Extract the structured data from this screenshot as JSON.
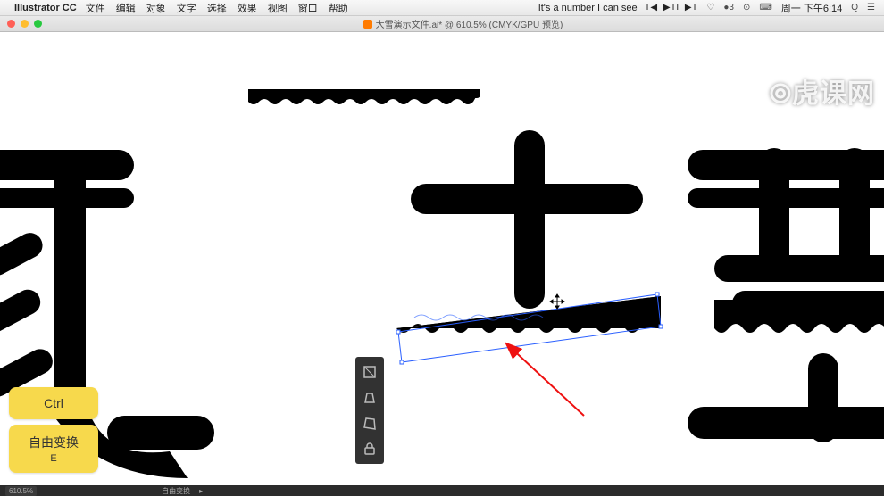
{
  "menubar": {
    "app_name": "Illustrator CC",
    "items": [
      "文件",
      "编辑",
      "对象",
      "文字",
      "选择",
      "效果",
      "视图",
      "窗口",
      "帮助"
    ],
    "song_title": "It's a number I can see",
    "playback": "I◀ ▶II ▶I",
    "battery": "●3",
    "wifi": "⌃",
    "keyboard": "⌨",
    "day_time": "周一 下午6:14",
    "search": "Q",
    "menu_icon": "☰"
  },
  "document": {
    "title": "大雪演示文件.ai* @ 610.5% (CMYK/GPU 预览)"
  },
  "key_hints": {
    "hint1": {
      "primary": "Ctrl"
    },
    "hint2": {
      "primary": "自由变换",
      "secondary": "E"
    }
  },
  "statusbar": {
    "zoom": "610.5%",
    "tool": "自由变换"
  },
  "watermark": "⦾虎课网",
  "tool_panel": {
    "icons": [
      "free-transform-icon",
      "perspective-icon",
      "puppet-warp-icon",
      "distort-icon"
    ]
  }
}
